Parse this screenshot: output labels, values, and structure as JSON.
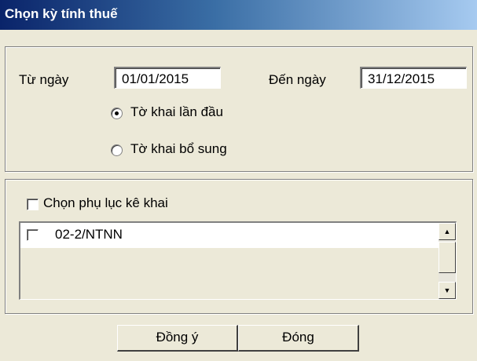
{
  "window": {
    "title": "Chọn kỳ tính thuế"
  },
  "period": {
    "from_label": "Từ ngày",
    "from_value": "01/01/2015",
    "to_label": "Đến ngày",
    "to_value": "31/12/2015"
  },
  "declaration_type": {
    "options": [
      {
        "label": "Tờ khai lần đầu",
        "selected": true
      },
      {
        "label": "Tờ khai bổ sung",
        "selected": false
      }
    ]
  },
  "appendix": {
    "checkbox_label": "Chọn phụ lục kê khai",
    "checked": false,
    "items": [
      {
        "label": "02-2/NTNN",
        "checked": false
      }
    ]
  },
  "buttons": {
    "ok_label": "Đồng ý",
    "close_label": "Đóng"
  },
  "colors": {
    "title_bar_start": "#0a246a",
    "title_bar_end": "#a6caf0",
    "window_bg": "#ece9d8"
  }
}
